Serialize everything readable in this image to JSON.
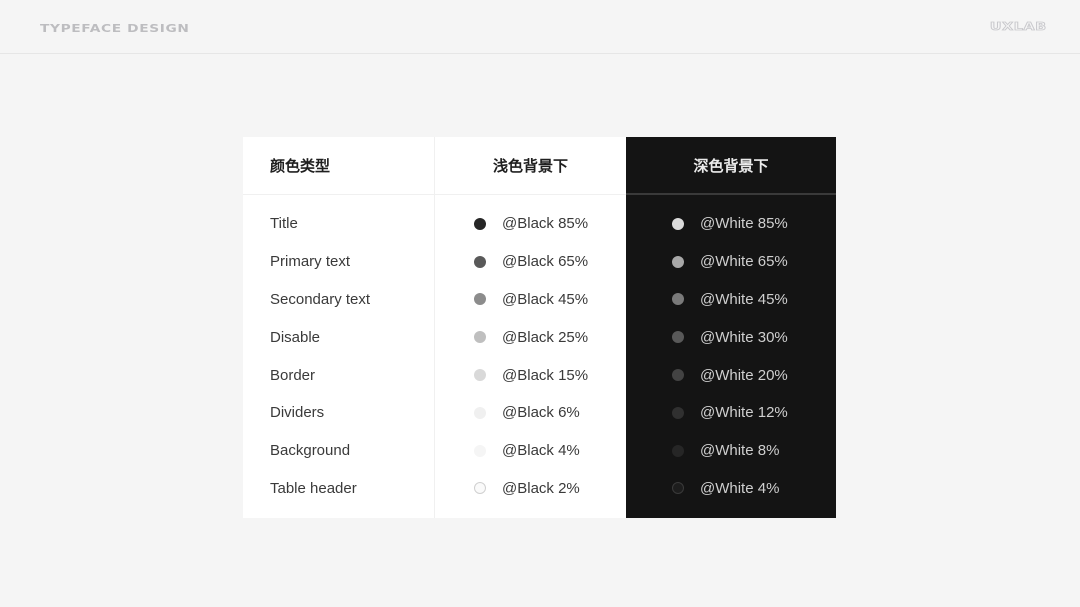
{
  "header": {
    "left_label": "TYPEFACE DESIGN",
    "right_label": "UXLAB"
  },
  "table": {
    "columns": {
      "type": "颜色类型",
      "light": "浅色背景下",
      "dark": "深色背景下"
    },
    "rows": [
      {
        "type": "Title",
        "light": "@Black 85%",
        "light_color": "#262626",
        "dark": "@White 85%",
        "dark_color": "#dbdbdb"
      },
      {
        "type": "Primary text",
        "light": "@Black 65%",
        "light_color": "#595959",
        "dark": "@White 65%",
        "dark_color": "#a8a8a8"
      },
      {
        "type": "Secondary text",
        "light": "@Black 45%",
        "light_color": "#8c8c8c",
        "dark": "@White 45%",
        "dark_color": "#7a7a7a"
      },
      {
        "type": "Disable",
        "light": "@Black 25%",
        "light_color": "#bfbfbf",
        "dark": "@White 30%",
        "dark_color": "#595959"
      },
      {
        "type": "Border",
        "light": "@Black 15%",
        "light_color": "#d9d9d9",
        "dark": "@White 20%",
        "dark_color": "#434343"
      },
      {
        "type": "Dividers",
        "light": "@Black 6%",
        "light_color": "#f0f0f0",
        "dark": "@White 12%",
        "dark_color": "#303030"
      },
      {
        "type": "Background",
        "light": "@Black 4%",
        "light_color": "#f5f5f5",
        "dark": "@White 8%",
        "dark_color": "#262626"
      },
      {
        "type": "Table header",
        "light": "@Black 2%",
        "light_color": "#fafafa",
        "dark": "@White 4%",
        "dark_color": "#1d1d1d"
      }
    ]
  }
}
